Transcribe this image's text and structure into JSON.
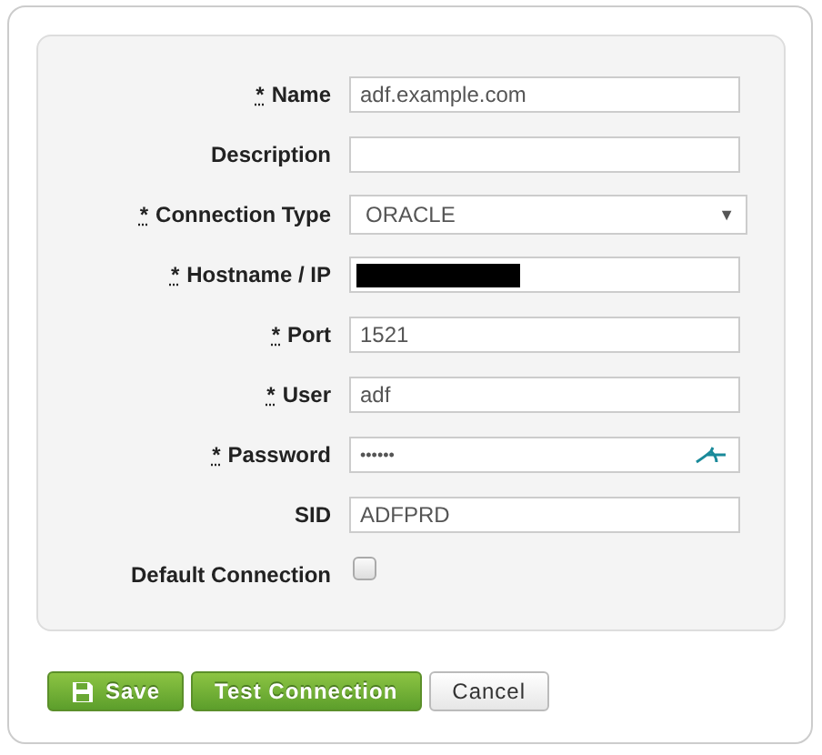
{
  "fields": [
    {
      "kind": "text",
      "required_mark": "*",
      "label": "Name",
      "value": "adf.example.com"
    },
    {
      "kind": "text",
      "label": "Description"
    },
    {
      "kind": "select",
      "required_mark": "*",
      "label": "Connection Type",
      "value": "ORACLE",
      "caret": "▼"
    },
    {
      "kind": "redacted",
      "required_mark": "*",
      "label": "Hostname / IP"
    },
    {
      "kind": "text",
      "required_mark": "*",
      "label": "Port",
      "value": "1521"
    },
    {
      "kind": "text",
      "required_mark": "*",
      "label": "User",
      "value": "adf"
    },
    {
      "kind": "password",
      "required_mark": "*",
      "label": "Password",
      "value": "••••••"
    },
    {
      "kind": "text",
      "label": "SID",
      "value": "ADFPRD"
    },
    {
      "kind": "checkbox",
      "label": "Default Connection",
      "checked": false
    }
  ],
  "buttons": [
    {
      "kind": "save",
      "label": "Save"
    },
    {
      "kind": "primary",
      "label": "Test Connection"
    },
    {
      "kind": "default",
      "label": "Cancel"
    }
  ]
}
